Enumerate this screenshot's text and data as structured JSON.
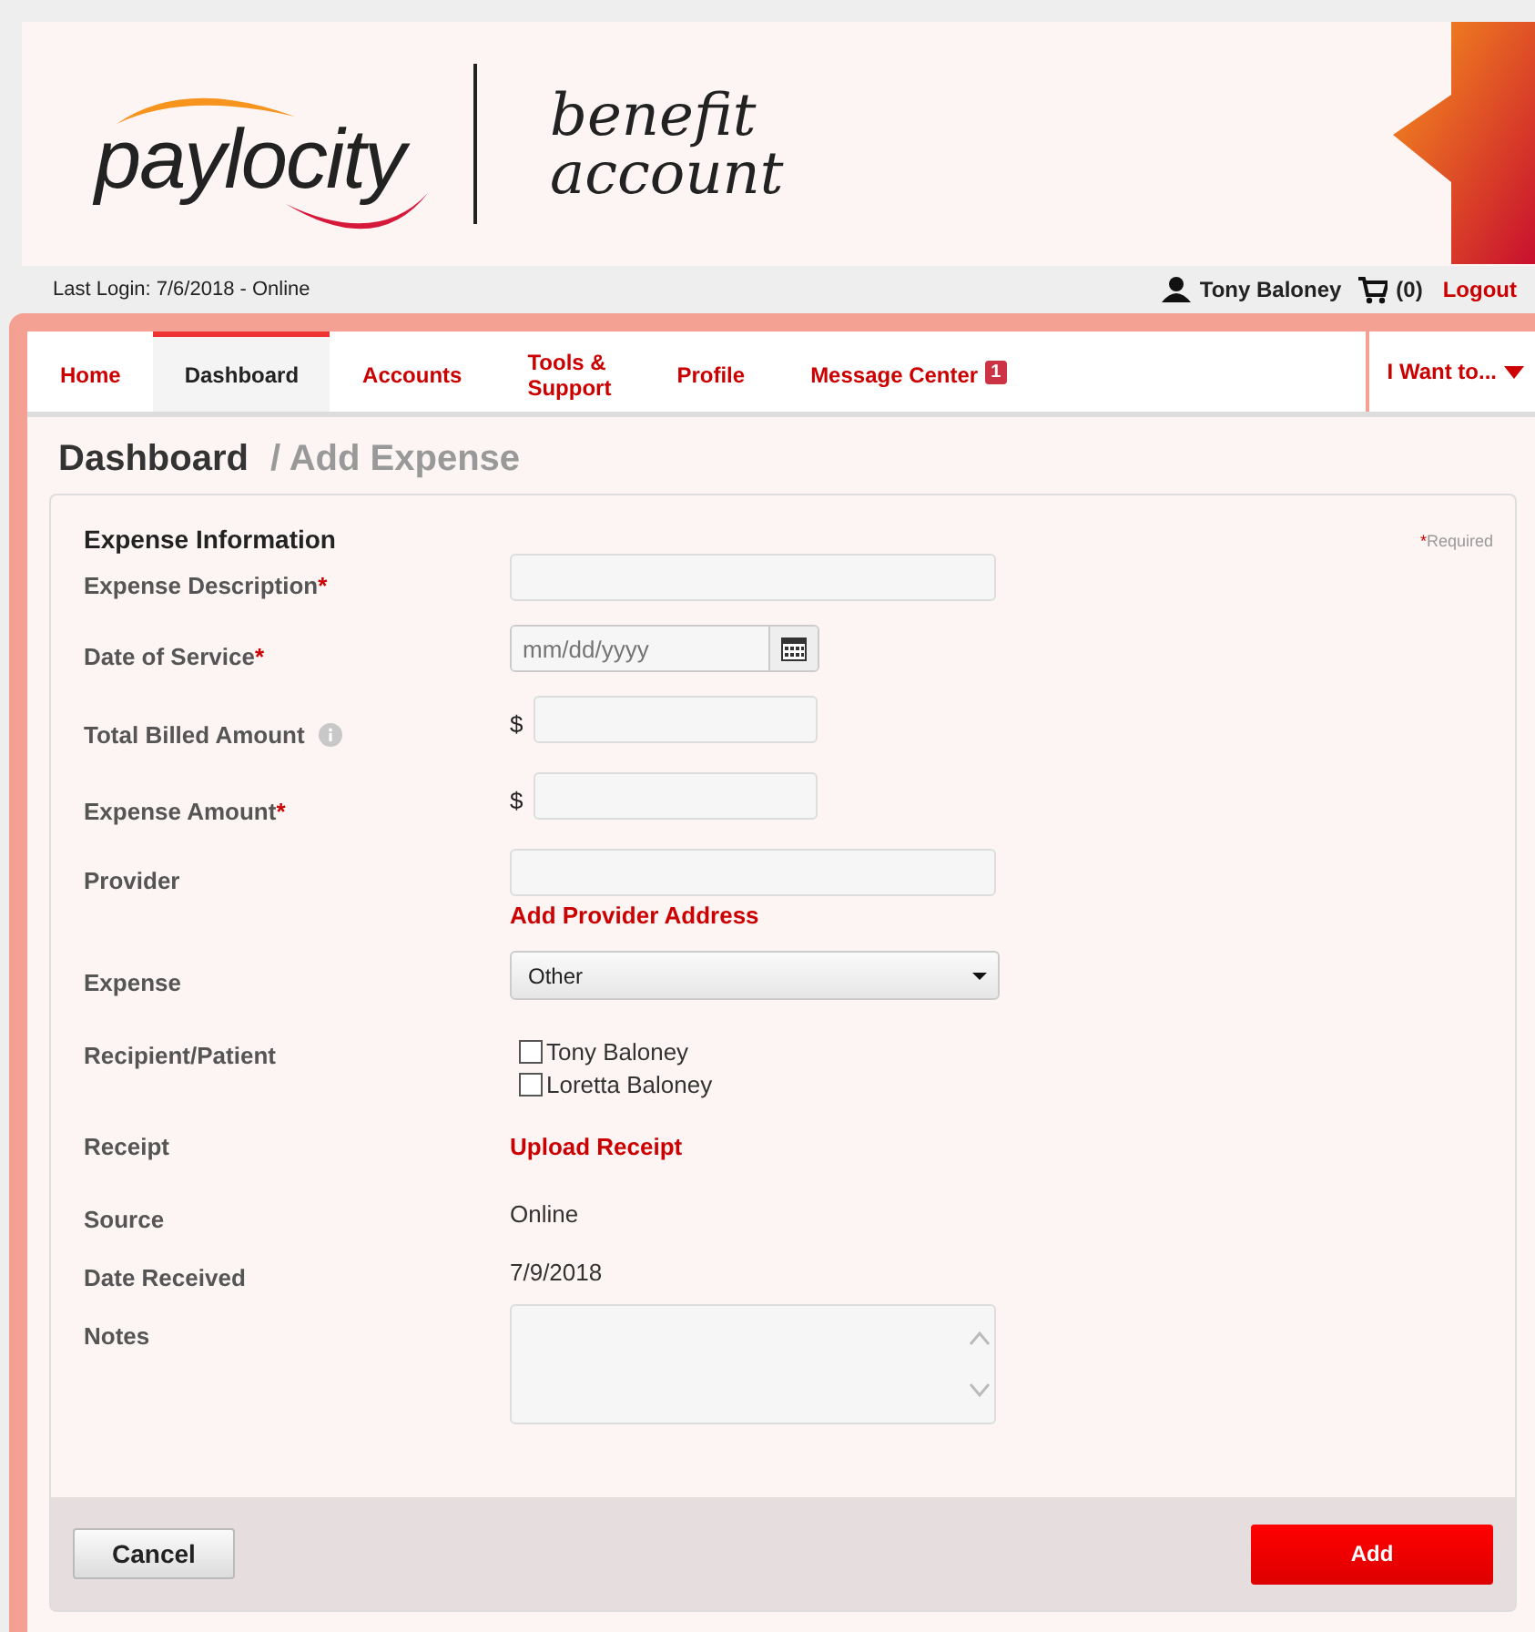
{
  "header": {
    "logo": "paylocity",
    "product_line_1": "benefit",
    "product_line_2": "account"
  },
  "user_bar": {
    "last_login": "Last Login: 7/6/2018 - Online",
    "user_name": "Tony Baloney",
    "cart_count": "(0)",
    "logout": "Logout"
  },
  "nav": {
    "tabs": [
      {
        "label": "Home",
        "selected": false
      },
      {
        "label": "Dashboard",
        "selected": true
      },
      {
        "label": "Accounts",
        "selected": false
      },
      {
        "label": "Tools &\nSupport",
        "selected": false
      },
      {
        "label": "Profile",
        "selected": false
      },
      {
        "label": "Message Center",
        "selected": false,
        "badge": "1"
      }
    ],
    "menu": "I Want to..."
  },
  "breadcrumb": {
    "current": "Dashboard",
    "sub": "/ Add Expense"
  },
  "form": {
    "title": "Expense Information",
    "required_note": "Required",
    "required_mark": "*",
    "rows": [
      {
        "kind": "text",
        "label": "Expense Description",
        "required": true
      },
      {
        "kind": "date",
        "label": "Date of Service",
        "required": true,
        "placeholder": "mm/dd/yyyy"
      },
      {
        "kind": "money",
        "label": "Total Billed Amount",
        "required": false,
        "info": true,
        "currency": "$"
      },
      {
        "kind": "money",
        "label": "Expense Amount",
        "required": true,
        "currency": "$"
      },
      {
        "kind": "text",
        "label": "Provider",
        "required": false,
        "link": "Add Provider Address"
      },
      {
        "kind": "select",
        "label": "Expense",
        "required": false,
        "value": "Other"
      },
      {
        "kind": "checks",
        "label": "Recipient/Patient",
        "required": false,
        "options": [
          {
            "label": "Tony Baloney",
            "checked": false
          },
          {
            "label": "Loretta Baloney",
            "checked": false
          }
        ]
      },
      {
        "kind": "link",
        "label": "Receipt",
        "required": false,
        "link": "Upload Receipt"
      },
      {
        "kind": "value",
        "label": "Source",
        "required": false,
        "value": "Online"
      },
      {
        "kind": "value",
        "label": "Date Received",
        "required": false,
        "value": "7/9/2018"
      },
      {
        "kind": "textarea",
        "label": "Notes",
        "required": false
      }
    ]
  },
  "buttons": {
    "cancel": "Cancel",
    "add": "Add"
  }
}
